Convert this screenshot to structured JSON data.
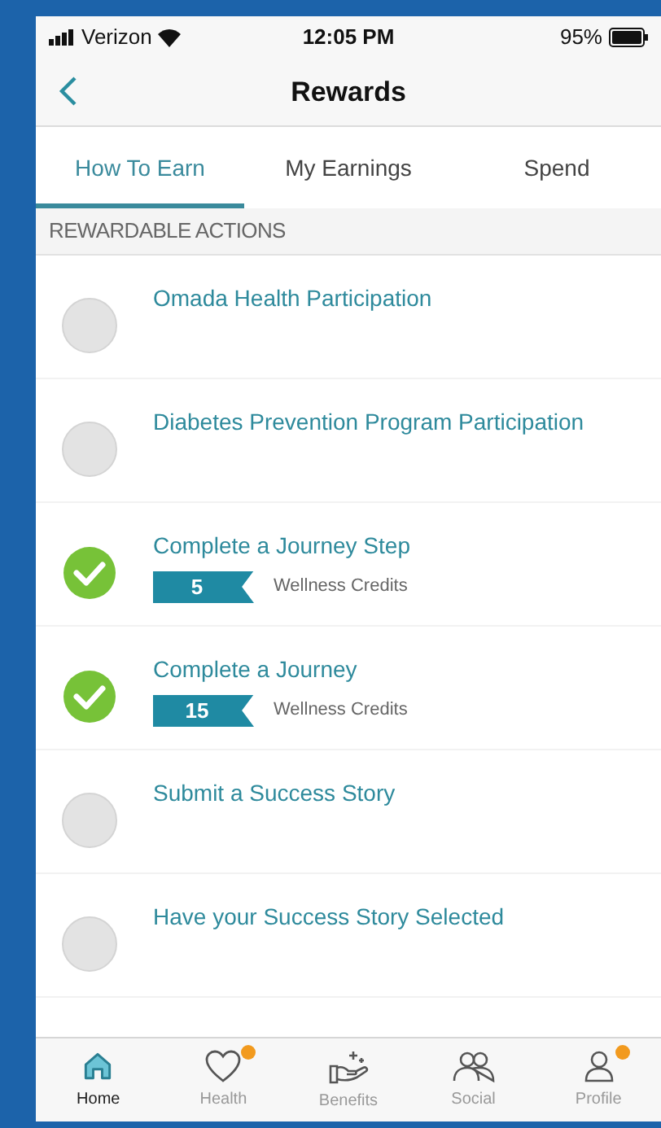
{
  "status_bar": {
    "carrier": "Verizon",
    "time": "12:05 PM",
    "battery": "95%"
  },
  "nav": {
    "title": "Rewards"
  },
  "tabs": [
    {
      "label": "How To Earn",
      "selected": true
    },
    {
      "label": "My Earnings",
      "selected": false
    },
    {
      "label": "Spend",
      "selected": false
    }
  ],
  "section_header": "REWARDABLE ACTIONS",
  "actions": [
    {
      "title": "Omada Health Participation",
      "completed": false
    },
    {
      "title": "Diabetes Prevention Program Participation",
      "completed": false
    },
    {
      "title": "Complete a Journey Step",
      "completed": true,
      "credits": "5",
      "credits_label": "Wellness Credits"
    },
    {
      "title": "Complete a Journey",
      "completed": true,
      "credits": "15",
      "credits_label": "Wellness Credits"
    },
    {
      "title": "Submit a Success Story",
      "completed": false
    },
    {
      "title": "Have your Success Story Selected",
      "completed": false
    }
  ],
  "tab_bar": [
    {
      "label": "Home",
      "kind": "home",
      "selected": true,
      "badge": false
    },
    {
      "label": "Health",
      "kind": "heart",
      "selected": false,
      "badge": true
    },
    {
      "label": "Benefits",
      "kind": "hand",
      "selected": false,
      "badge": false
    },
    {
      "label": "Social",
      "kind": "people",
      "selected": false,
      "badge": false
    },
    {
      "label": "Profile",
      "kind": "person",
      "selected": false,
      "badge": true
    }
  ]
}
